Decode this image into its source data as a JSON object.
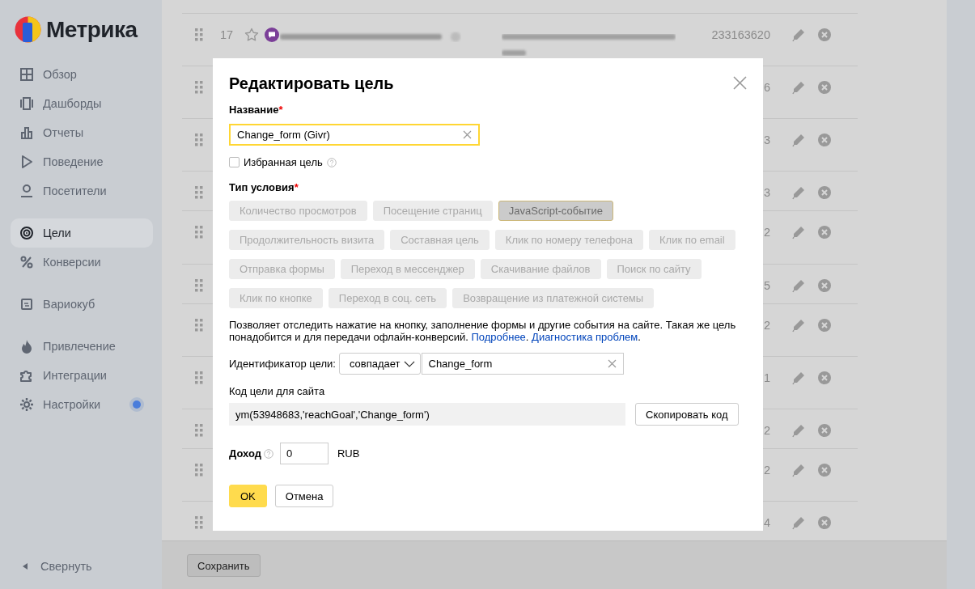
{
  "sidebar": {
    "logo": "Метрика",
    "groups": [
      [
        {
          "label": "Обзор",
          "selected": false,
          "notification": false
        },
        {
          "label": "Дашборды",
          "selected": false,
          "notification": false
        },
        {
          "label": "Отчеты",
          "selected": false,
          "notification": false
        },
        {
          "label": "Поведение",
          "selected": false,
          "notification": false
        },
        {
          "label": "Посетители",
          "selected": false,
          "notification": false
        }
      ],
      [
        {
          "label": "Цели",
          "selected": true,
          "notification": false
        },
        {
          "label": "Конверсии",
          "selected": false,
          "notification": false
        }
      ],
      [
        {
          "label": "Вариокуб",
          "selected": false,
          "notification": false
        }
      ],
      [
        {
          "label": "Привлечение",
          "selected": false,
          "notification": false
        },
        {
          "label": "Интеграции",
          "selected": false,
          "notification": false
        },
        {
          "label": "Настройки",
          "selected": false,
          "notification": true
        }
      ]
    ],
    "collapse": "Свернуть"
  },
  "table": {
    "rows": [
      {
        "number": "17",
        "starred": false,
        "value": "233163620"
      },
      {
        "value": "6"
      },
      {
        "value": "3"
      },
      {
        "value": "3"
      },
      {
        "value": "2"
      },
      {
        "value": "5"
      },
      {
        "value": "2"
      },
      {
        "value": "1"
      },
      {
        "value": "2"
      },
      {
        "value": "2"
      },
      {
        "value": "4"
      }
    ]
  },
  "modal": {
    "title": "Редактировать цель",
    "name": {
      "label": "Название",
      "required_mark": "*",
      "value": "Change_form (Givr)"
    },
    "favorite": {
      "label": "Избранная цель",
      "checked": false
    },
    "condition_type": {
      "label": "Тип условия",
      "required_mark": "*",
      "options": [
        [
          {
            "label": "Количество просмотров",
            "selected": false
          },
          {
            "label": "Посещение страниц",
            "selected": false
          },
          {
            "label": "JavaScript-событие",
            "selected": true
          }
        ],
        [
          {
            "label": "Продолжительность визита",
            "selected": false
          },
          {
            "label": "Составная цель",
            "selected": false
          },
          {
            "label": "Клик по номеру телефона",
            "selected": false
          },
          {
            "label": "Клик по email",
            "selected": false
          }
        ],
        [
          {
            "label": "Отправка формы",
            "selected": false
          },
          {
            "label": "Переход в мессенджер",
            "selected": false
          },
          {
            "label": "Скачивание файлов",
            "selected": false
          },
          {
            "label": "Поиск по сайту",
            "selected": false
          }
        ],
        [
          {
            "label": "Клик по кнопке",
            "selected": false
          },
          {
            "label": "Переход в соц. сеть",
            "selected": false
          },
          {
            "label": "Возвращение из платежной системы",
            "selected": false
          }
        ]
      ]
    },
    "description": [
      {
        "kind": "text",
        "text": "Позволяет отследить нажатие на кнопку, заполнение формы и другие события на сайте. Такая же цель понадобится и для передачи офлайн-конверсий. "
      },
      {
        "kind": "link",
        "text": "Подробнее"
      },
      {
        "kind": "text",
        "text": ". "
      },
      {
        "kind": "link",
        "text": "Диагностика проблем"
      },
      {
        "kind": "text",
        "text": "."
      }
    ],
    "identifier": {
      "label": "Идентификатор цели:",
      "match": "совпадает",
      "value": "Change_form"
    },
    "code": {
      "label": "Код цели для сайта",
      "code": "ym(53948683,'reachGoal','Change_form')",
      "copy_button": "Скопировать код"
    },
    "revenue": {
      "label": "Доход",
      "value": "0",
      "currency": "RUB"
    },
    "buttons": [
      {
        "label": "OK",
        "kind": "primary"
      },
      {
        "label": "Отмена",
        "kind": "secondary"
      }
    ]
  },
  "bottom_bar": {
    "save_button": "Сохранить"
  }
}
